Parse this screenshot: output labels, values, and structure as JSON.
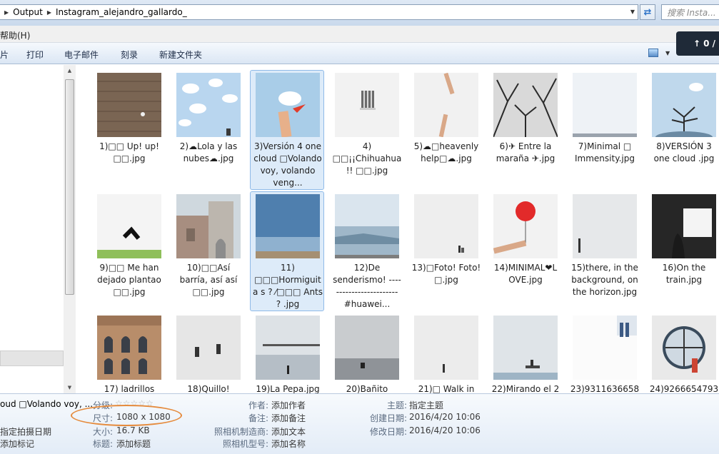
{
  "address": {
    "crumbs": [
      "Output",
      "Instagram_alejandro_gallardo_"
    ],
    "search_placeholder": "搜索 Insta..."
  },
  "menu": {
    "help": "帮助(H)"
  },
  "share_badge": "0 /",
  "toolbar": {
    "items": [
      "片",
      "打印",
      "电子邮件",
      "刻录",
      "新建文件夹"
    ]
  },
  "files": [
    {
      "name": "1)□□ Up! up! □□.jpg",
      "thumb": "wall"
    },
    {
      "name": "2)☁Lola y las nubes☁.jpg",
      "thumb": "clouds"
    },
    {
      "name": "3)Versión 4 one cloud □Volando voy, volando veng...",
      "thumb": "plane",
      "selected": true
    },
    {
      "name": "4) □□¡¡Chihuahua!! □□.jpg",
      "thumb": "window"
    },
    {
      "name": "5)☁□heavenly help□☁.jpg",
      "thumb": "hands"
    },
    {
      "name": "6)✈ Entre la maraña ✈.jpg",
      "thumb": "trees"
    },
    {
      "name": "7)Minimal □ Immensity.jpg",
      "thumb": "fog"
    },
    {
      "name": "8)VERSIÓN 3 one cloud .jpg",
      "thumb": "tree"
    },
    {
      "name": "9)□□ Me han dejado plantao □□.jpg",
      "thumb": "grass"
    },
    {
      "name": "10)□□Así barría, así así □□.jpg",
      "thumb": "church"
    },
    {
      "name": "11) □□□Hormiguita s ? ⁄□□□ Ants ? .jpg",
      "thumb": "sky",
      "selected": true
    },
    {
      "name": "12)De senderismo! ------------------------#huawei...",
      "thumb": "sea"
    },
    {
      "name": "13)□Foto! Foto!□.jpg",
      "thumb": "mist"
    },
    {
      "name": "14)MINIMAL❤L OVE.jpg",
      "thumb": "balloon"
    },
    {
      "name": "15)there, in the background, on the horizon.jpg",
      "thumb": "figure"
    },
    {
      "name": "16)On the train.jpg",
      "thumb": "train"
    },
    {
      "name": "17) ladrillos",
      "thumb": "building"
    },
    {
      "name": "18)Quillo!",
      "thumb": "jump"
    },
    {
      "name": "19)La Pepa.jpg",
      "thumb": "bridge"
    },
    {
      "name": "20)Bañito",
      "thumb": "beach"
    },
    {
      "name": "21)□ Walk in",
      "thumb": "walk"
    },
    {
      "name": "22)Mirando el 2",
      "thumb": "bench"
    },
    {
      "name": "23)9311636658",
      "thumb": "legs"
    },
    {
      "name": "24)9266654793",
      "thumb": "porthole"
    }
  ],
  "details": {
    "selected_name": "oud □Volando voy, ...",
    "rating_label": "分级:",
    "size_label": "尺寸:",
    "size_value": "1080 x 1080",
    "date_taken": "指定拍摄日期",
    "add_tag": "添加标记",
    "filesize_label": "大小:",
    "filesize_value": "16.7 KB",
    "title_label": "标题:",
    "title_value": "添加标题",
    "author_label": "作者:",
    "author_value": "添加作者",
    "comment_label": "备注:",
    "comment_value": "添加备注",
    "maker_label": "照相机制造商:",
    "maker_value": "添加文本",
    "model_label": "照相机型号:",
    "model_value": "添加名称",
    "subject_label": "主题:",
    "subject_value": "指定主题",
    "created_label": "创建日期:",
    "created_value": "2016/4/20 10:06",
    "modified_label": "修改日期:",
    "modified_value": "2016/4/20 10:06"
  }
}
